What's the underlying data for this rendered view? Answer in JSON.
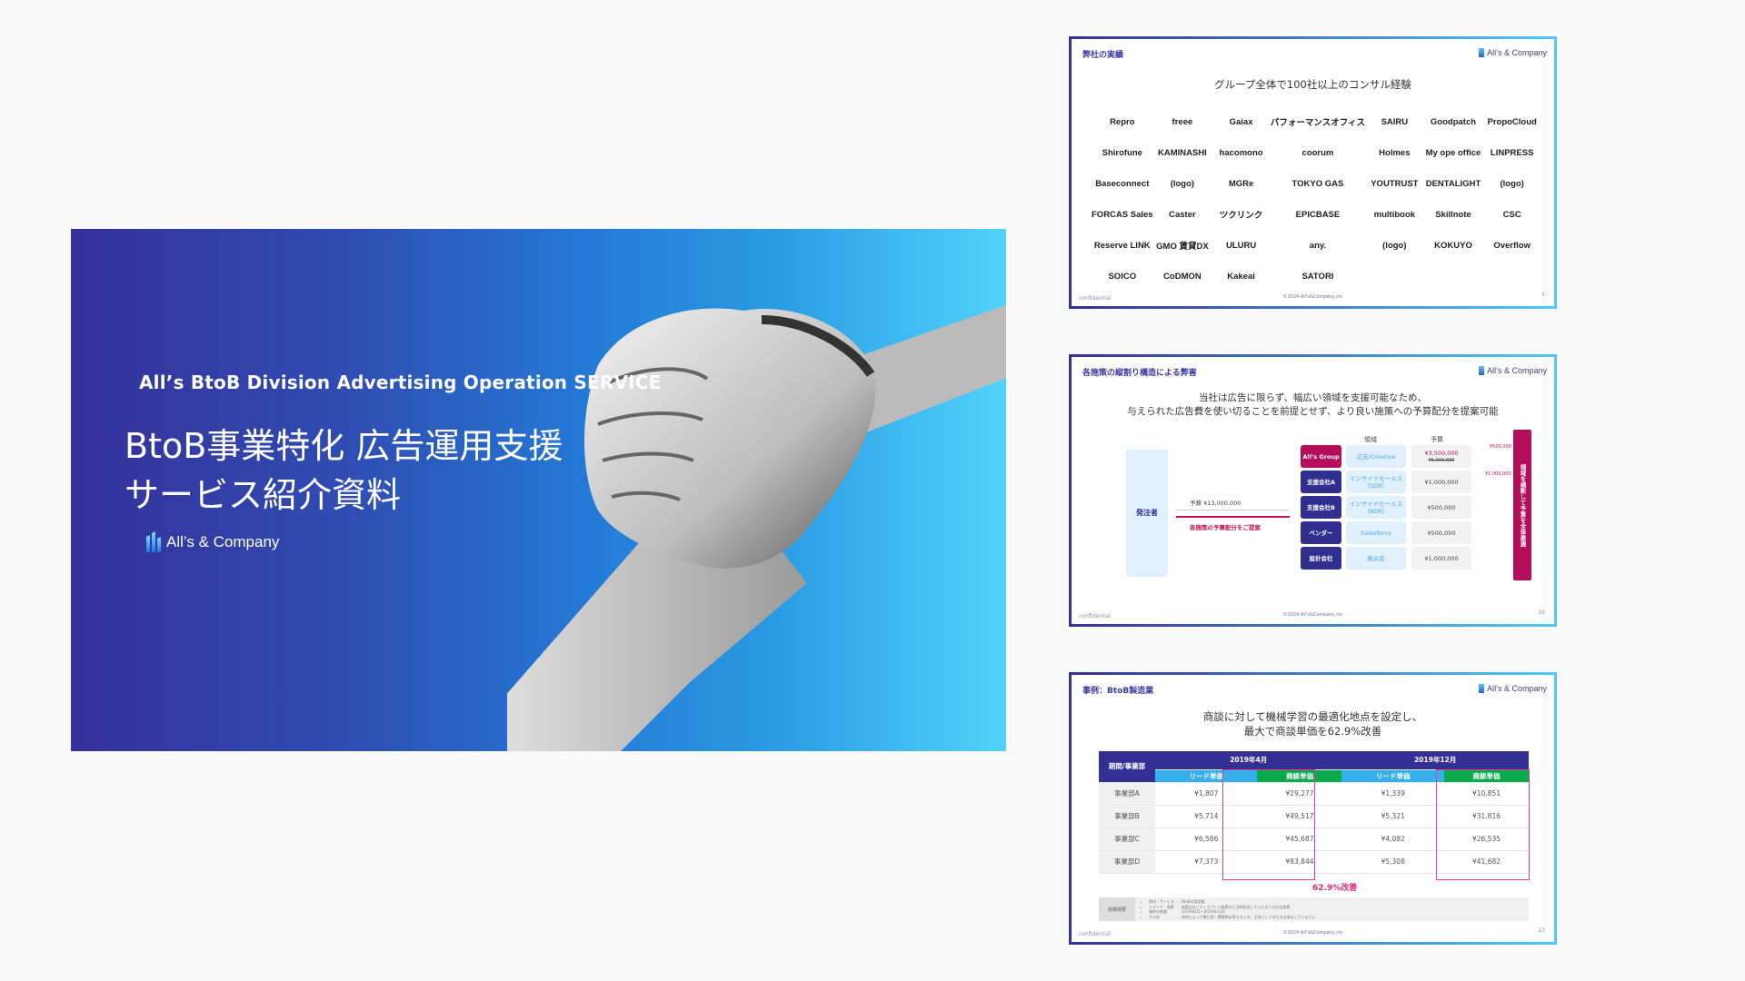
{
  "main_slide": {
    "subtitle": "All’s BtoB Division Advertising Operation SERVICE",
    "title": "BtoB事業特化 広告運用支援\nサービス紹介資料",
    "logo_text": "All’s & Company",
    "image": "handshake-photo",
    "gradient_colors": [
      "#35309a",
      "#2479d6",
      "#52d2fb"
    ]
  },
  "common": {
    "logo_text": "All’s & Company",
    "confidential": "confidential",
    "copyright": "©2024 All's&Company,inc"
  },
  "thumbnails": [
    {
      "heading": "弊社の実績",
      "lead": "グループ全体で100社以上のコンサル経験",
      "page": "5",
      "logos": [
        "Repro",
        "freee",
        "Gaiax",
        "パフォーマンスオフィス",
        "SAIRU",
        "Goodpatch",
        "PropoCloud",
        "Shirofune",
        "KAMINASHI",
        "hacomono",
        "coorum",
        "Holmes",
        "My ope office",
        "LINPRESS",
        "Baseconnect",
        "(logo)",
        "MGRe",
        "TOKYO GAS",
        "YOUTRUST",
        "DENTALIGHT",
        "(logo)",
        "FORCAS Sales",
        "Caster",
        "ツクリンク",
        "EPICBASE",
        "multibook",
        "Skillnote",
        "CSC",
        "Reserve LINK",
        "GMO 賃貸DX",
        "ULURU",
        "any.",
        "(logo)",
        "KOKUYO",
        "Overflow",
        "SOICO",
        "CoDMON",
        "Kakeai",
        "SATORI"
      ]
    },
    {
      "heading": "各施策の縦割り構造による弊害",
      "lead": "当社は広告に限らず、幅広い領域を支援可能なため、\n与えられた広告費を使い切ることを前提とせず、より良い施策への予算配分を提案可能",
      "page": "16",
      "client": "発注者",
      "budget_label": "予算 ¥13,000,000",
      "proposal_label": "各施策の予算配分をご提案",
      "col_domain": "領域",
      "col_budget": "予算",
      "rows": [
        {
          "org": "All’s Group",
          "domain": "広告/Creative",
          "budget": "¥3,500,000",
          "old_budget": "¥5,000,000"
        },
        {
          "org": "支援会社A",
          "domain": "インサイドセールス\n（SDR）",
          "budget": "¥1,000,000"
        },
        {
          "org": "支援会社B",
          "domain": "インサイドセールス\n（BDR）",
          "budget": "¥500,000"
        },
        {
          "org": "ベンダー",
          "domain": "Salesforce",
          "budget": "¥500,000"
        },
        {
          "org": "設計会社",
          "domain": "展示会",
          "budget": "¥1,000,000"
        }
      ],
      "transfer_1": "¥500,000",
      "transfer_2": "¥1,000,000",
      "side_bar": "領域を横断して予算を全体最適"
    },
    {
      "heading": "事例：BtoB製造業",
      "lead": "商談に対して機械学習の最適化地点を設定し、\n最大で商談単価を62.9%改善",
      "page": "23",
      "table": {
        "corner": "期間/事業部",
        "periods": [
          "2019年4月",
          "2019年12月"
        ],
        "subcols": [
          "リード単価",
          "商談単価",
          "リード単価",
          "商談単価"
        ],
        "rows": [
          {
            "dept": "事業部A",
            "values": [
              "¥1,807",
              "¥29,277",
              "¥1,339",
              "¥10,851"
            ]
          },
          {
            "dept": "事業部B",
            "values": [
              "¥5,714",
              "¥49,517",
              "¥5,321",
              "¥31,816"
            ]
          },
          {
            "dept": "事業部C",
            "values": [
              "¥6,586",
              "¥45,687",
              "¥4,082",
              "¥26,535"
            ]
          },
          {
            "dept": "事業部D",
            "values": [
              "¥7,373",
              "¥83,844",
              "¥5,308",
              "¥41,682"
            ]
          }
        ]
      },
      "improvement": "62.9%改善",
      "notes_label": "施策概要",
      "notes": [
        "商材・サービス　：BtoBの製造業",
        "メディア・施策　：検索広告とディスプレイ施策など当時配信していた全ての広告施策",
        "事例の期間　　　：2019年4月〜2019年12月",
        "その他　　　　　：商材によって繁忙期・閑散期は異なるため、全体としては大きな波はございません"
      ]
    }
  ]
}
